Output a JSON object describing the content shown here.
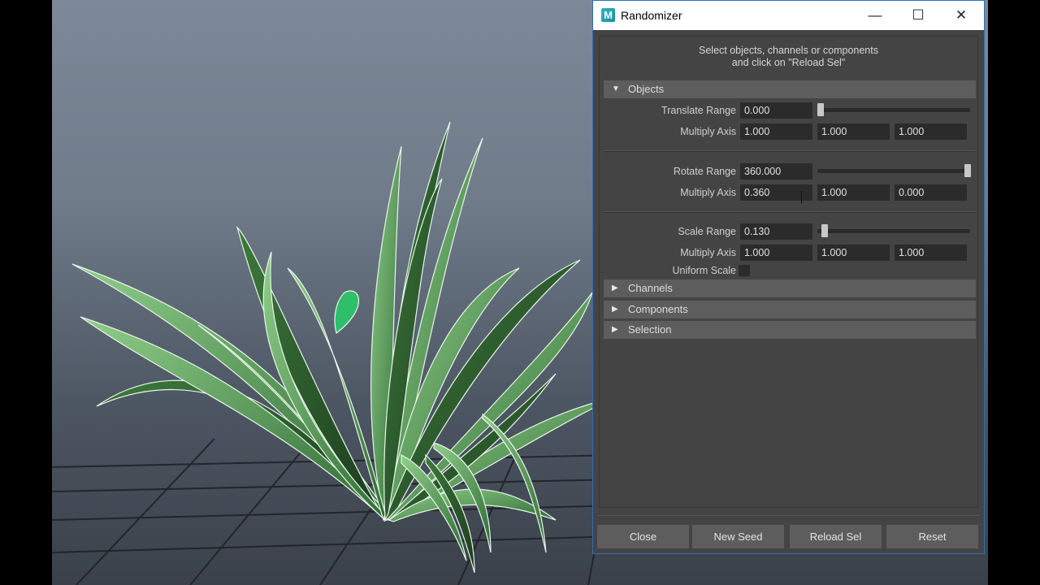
{
  "window": {
    "title": "Randomizer",
    "logo_letter": "M",
    "controls": {
      "minimize": "—",
      "maximize": "☐",
      "close": "✕"
    }
  },
  "instructions": {
    "line1": "Select objects, channels or components",
    "line2": "and click on \"Reload Sel\""
  },
  "objects": {
    "header": "Objects",
    "translate": {
      "label": "Translate Range",
      "value": "0.000",
      "slider_fraction": 0.0,
      "axis_label": "Multiply Axis",
      "axis": [
        "1.000",
        "1.000",
        "1.000"
      ]
    },
    "rotate": {
      "label": "Rotate Range",
      "value": "360.000",
      "slider_fraction": 1.0,
      "axis_label": "Multiply Axis",
      "axis": [
        "0.360",
        "1.000",
        "0.000"
      ]
    },
    "scale": {
      "label": "Scale Range",
      "value": "0.130",
      "slider_fraction": 0.03,
      "axis_label": "Multiply Axis",
      "axis": [
        "1.000",
        "1.000",
        "1.000"
      ],
      "uniform_label": "Uniform Scale",
      "uniform_checked": false
    }
  },
  "sections": [
    "Channels",
    "Components",
    "Selection"
  ],
  "buttons": {
    "close": "Close",
    "new_seed": "New Seed",
    "reload_sel": "Reload Sel",
    "reset": "Reset"
  }
}
